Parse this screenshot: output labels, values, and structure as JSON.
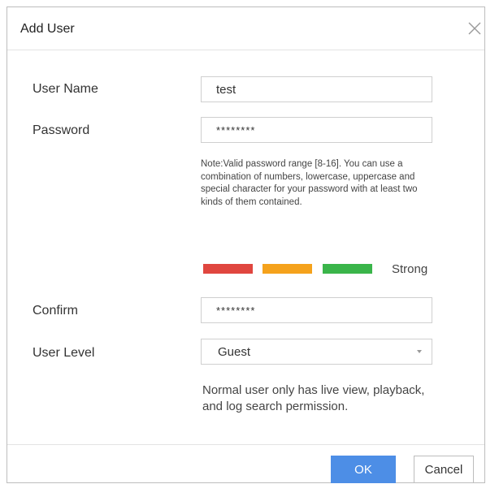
{
  "dialog": {
    "title": "Add User"
  },
  "form": {
    "username": {
      "label": "User Name",
      "value": "test"
    },
    "password": {
      "label": "Password",
      "value": "********"
    },
    "password_note": "Note:Valid password range [8-16]. You can use a combination of numbers, lowercase, uppercase and special character for your password with at least two kinds of them contained.",
    "strength": {
      "label": "Strong",
      "colors": [
        "#e0463f",
        "#f5a21c",
        "#3ab54a"
      ]
    },
    "confirm": {
      "label": "Confirm",
      "value": "********"
    },
    "user_level": {
      "label": "User Level",
      "selected": "Guest",
      "description": "Normal user only has live view, playback, and log search permission."
    }
  },
  "buttons": {
    "ok": "OK",
    "cancel": "Cancel"
  },
  "icons": {
    "close": "close-icon",
    "dropdown": "chevron-down-icon"
  },
  "colors": {
    "primary": "#4d8ee6"
  }
}
